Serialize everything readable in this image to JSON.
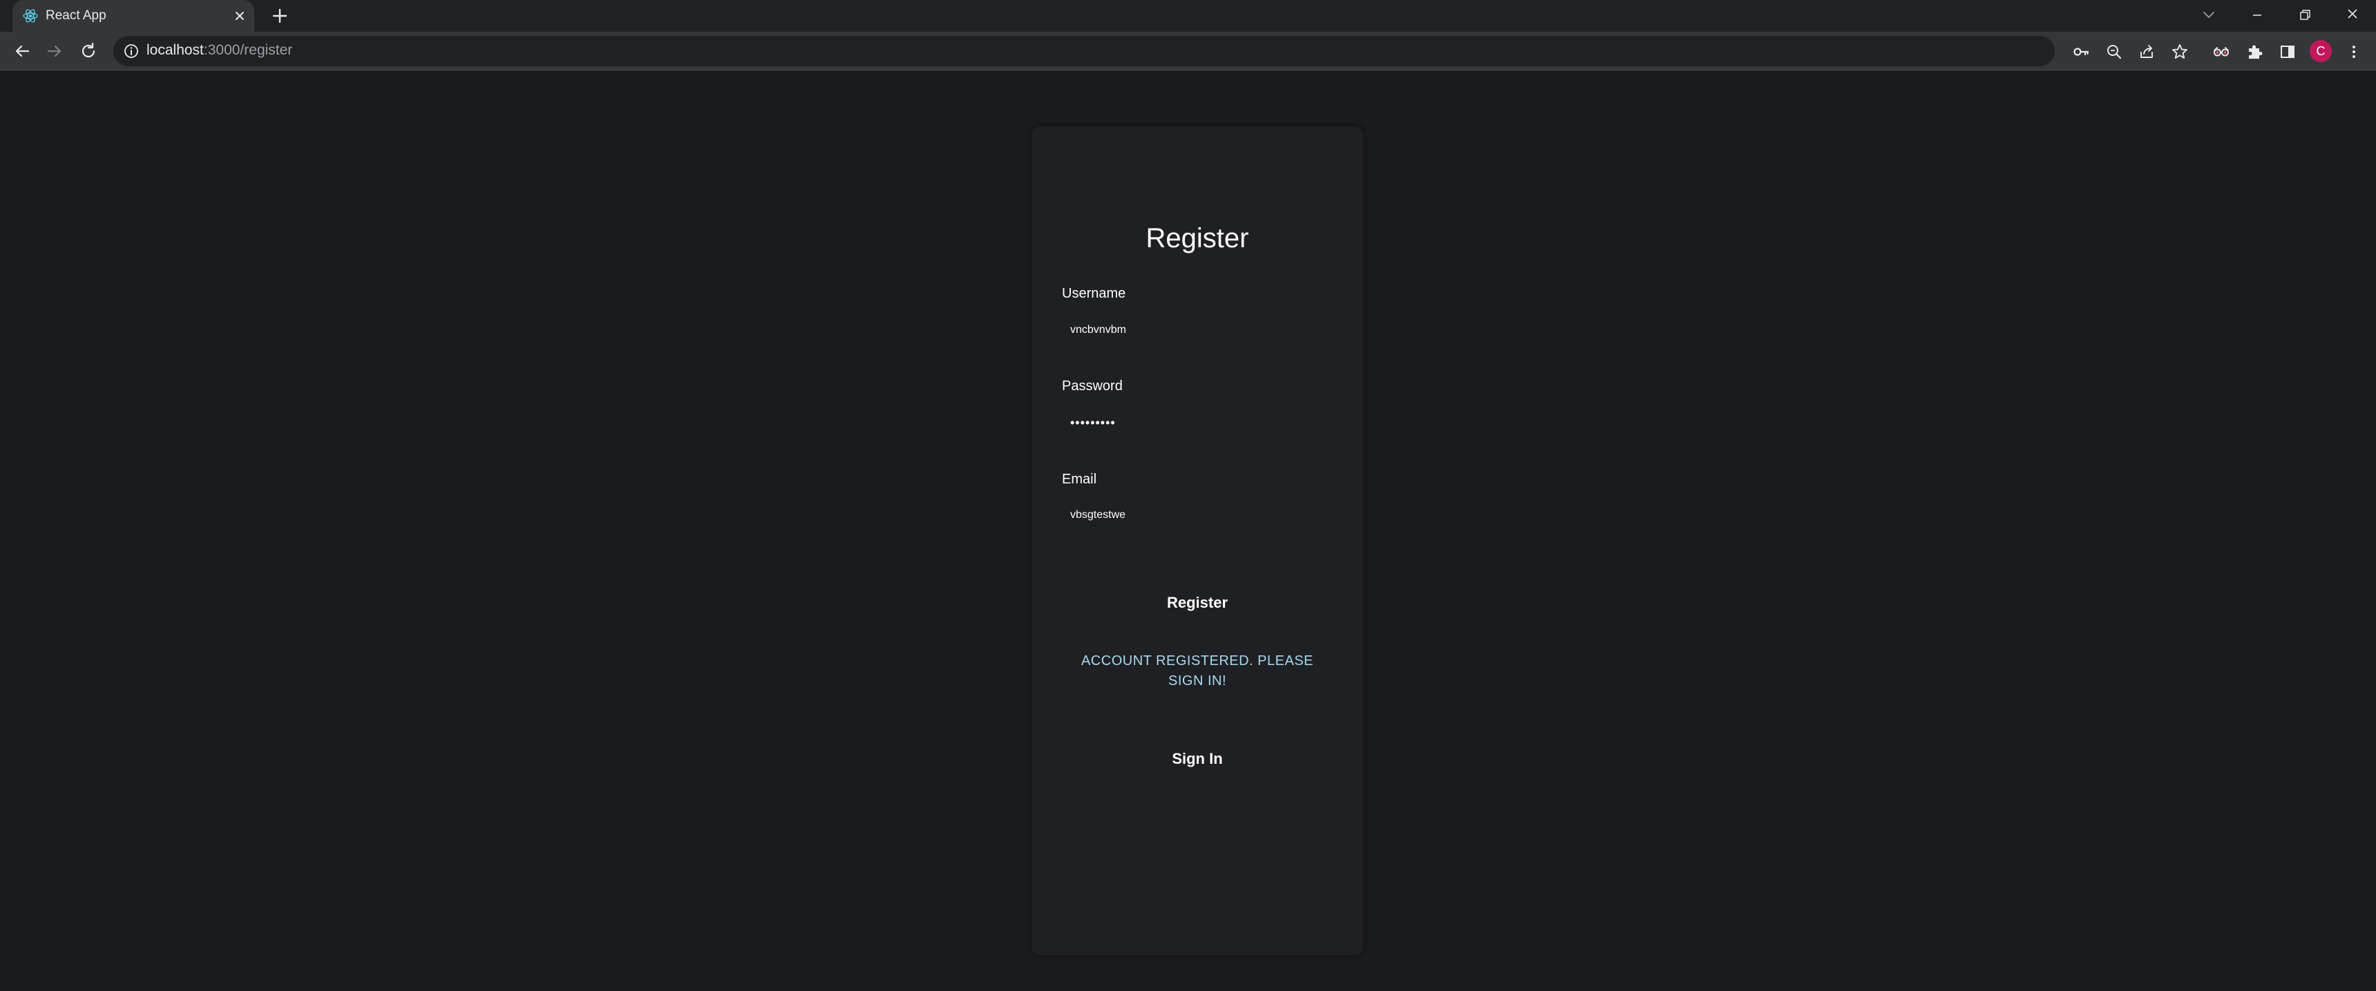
{
  "browser": {
    "tab_title": "React App",
    "url_host": "localhost",
    "url_path": ":3000/register",
    "profile_initial": "C"
  },
  "register_form": {
    "title": "Register",
    "username_label": "Username",
    "username_value": "vncbvnvbm",
    "password_label": "Password",
    "password_value": "•••••••••",
    "email_label": "Email",
    "email_value": "vbsgtestwe",
    "register_button": "Register",
    "status_message": "ACCOUNT REGISTERED. PLEASE SIGN IN!",
    "signin_button": "Sign In"
  },
  "colors": {
    "page_bg": "#1b1c1e",
    "card_bg": "#1f2023",
    "status_text": "#a8d8ef",
    "avatar_bg": "#c2185b"
  }
}
